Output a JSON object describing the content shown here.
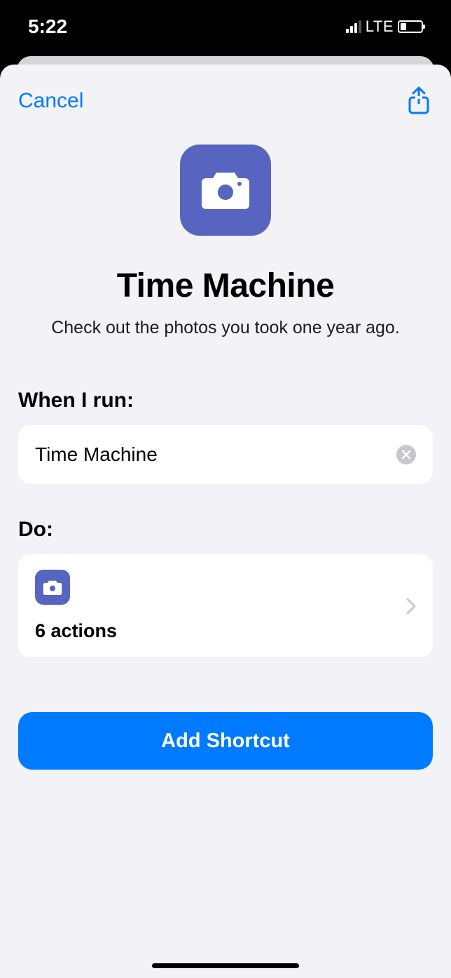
{
  "status": {
    "time": "5:22",
    "network": "LTE"
  },
  "header": {
    "cancel_label": "Cancel"
  },
  "shortcut": {
    "title": "Time Machine",
    "subtitle": "Check out the photos you took one year ago."
  },
  "sections": {
    "when_label": "When I run:",
    "when_value": "Time Machine",
    "do_label": "Do:",
    "do_actions": "6 actions"
  },
  "cta": {
    "label": "Add Shortcut"
  }
}
